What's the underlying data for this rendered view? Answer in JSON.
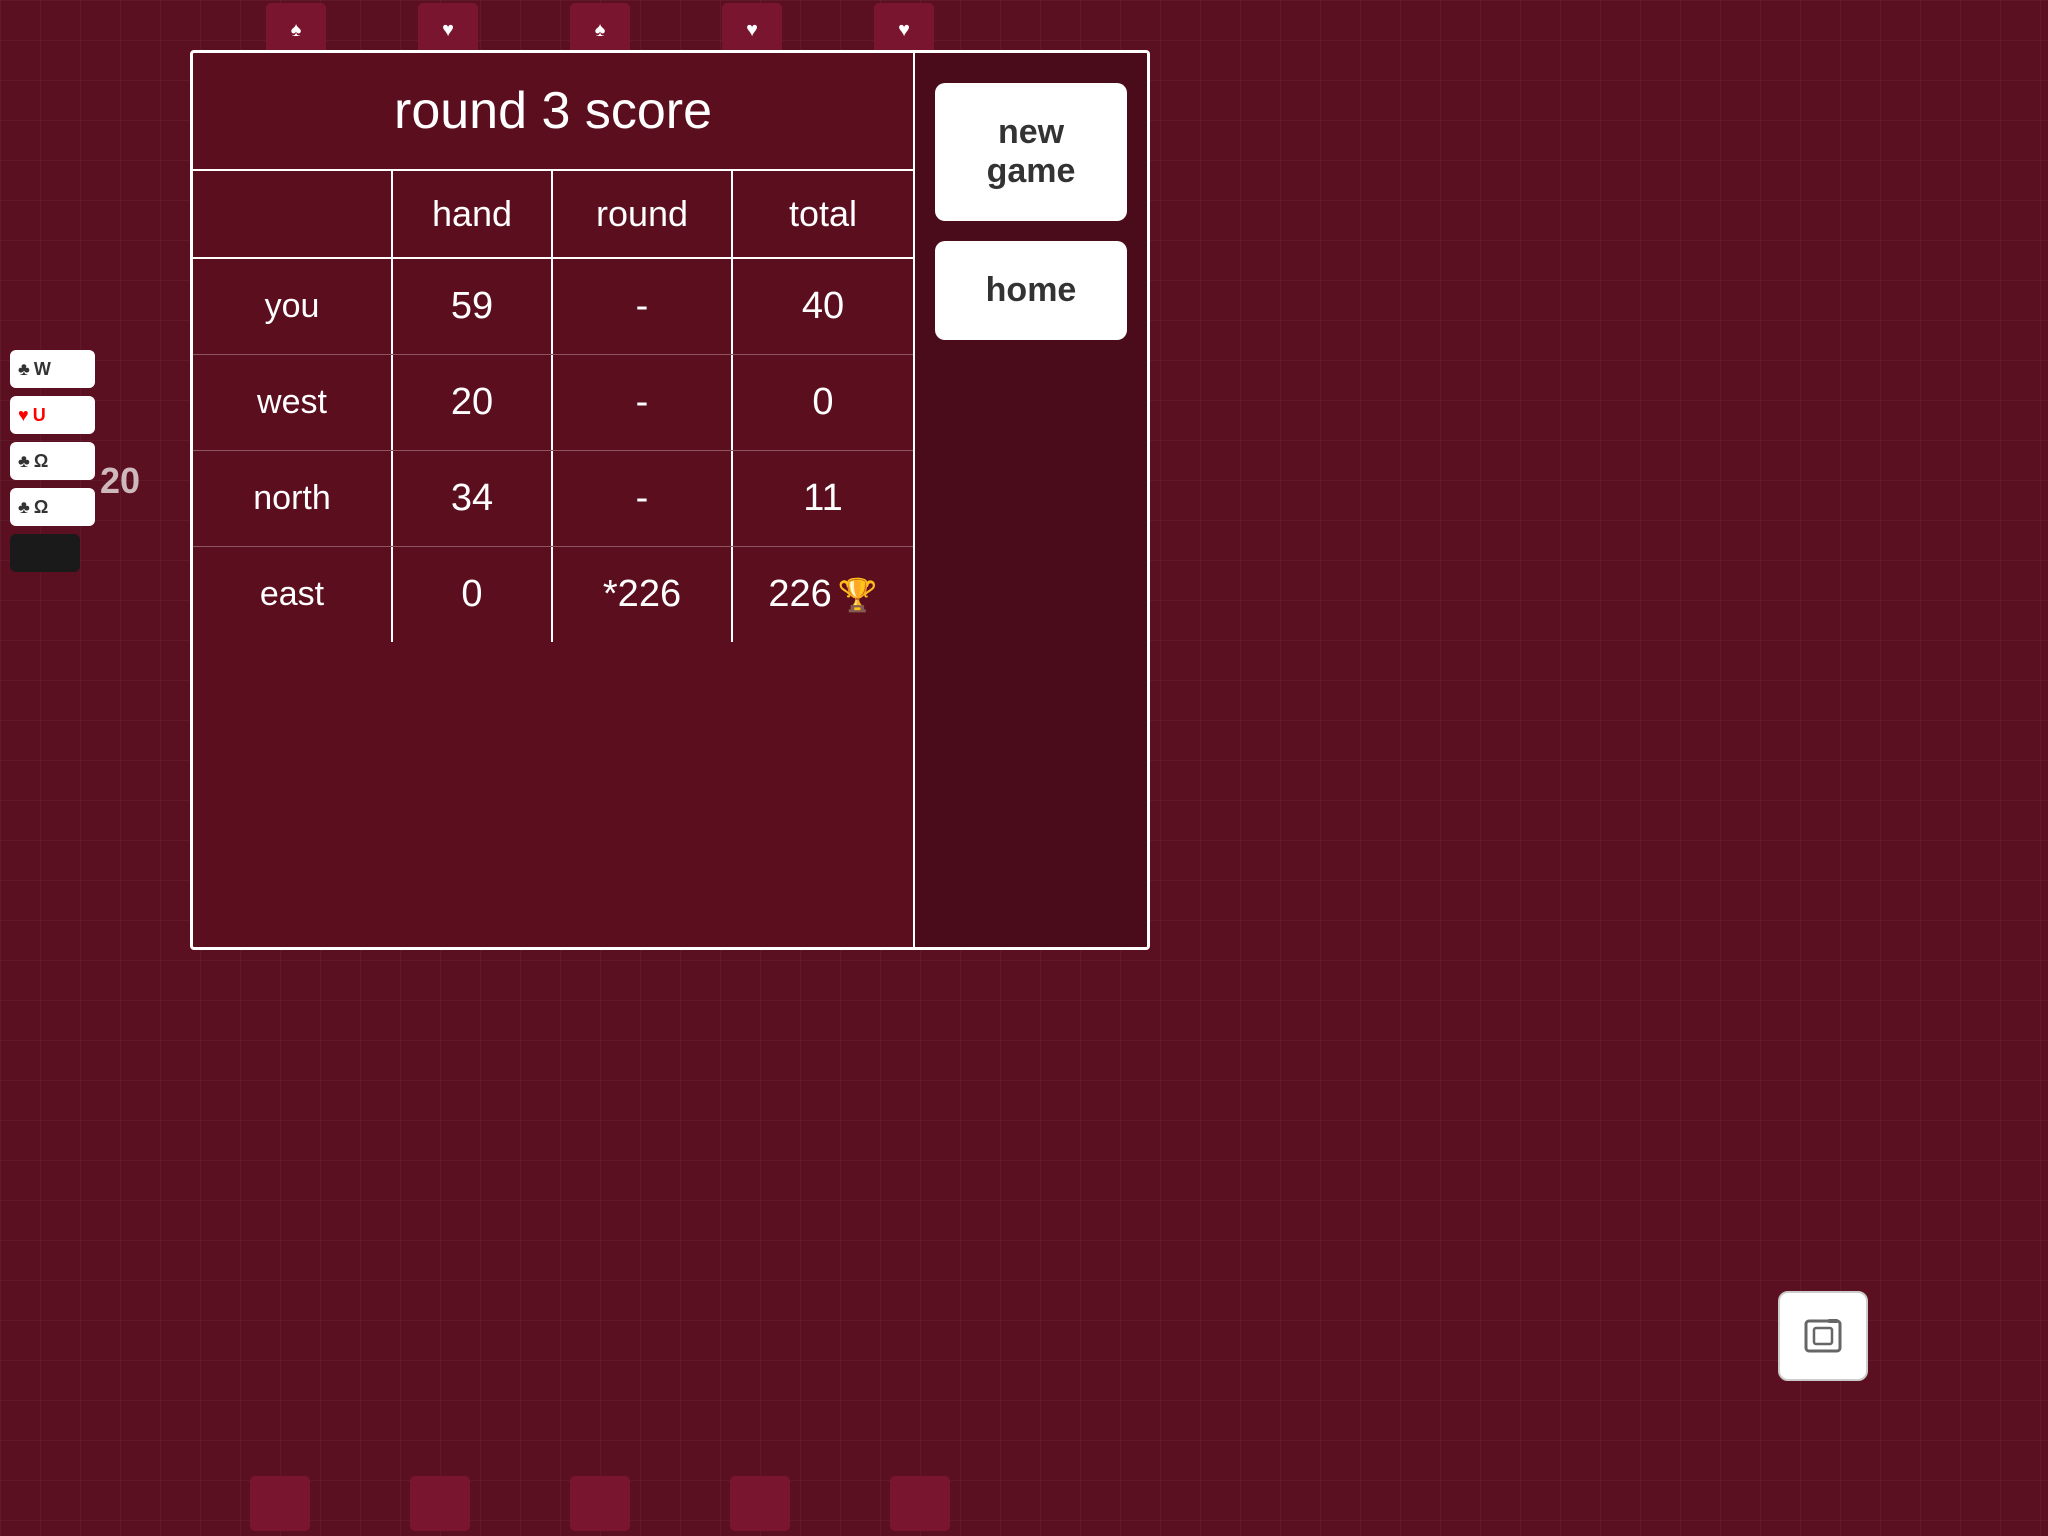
{
  "dialog": {
    "title": "round 3 score",
    "columns": {
      "player": "",
      "hand": "hand",
      "round": "round",
      "total": "total"
    },
    "rows": [
      {
        "player": "you",
        "hand": "59",
        "round": "-",
        "total": "40",
        "winner": false
      },
      {
        "player": "west",
        "hand": "20",
        "round": "-",
        "total": "0",
        "winner": false
      },
      {
        "player": "north",
        "hand": "34",
        "round": "-",
        "total": "11",
        "winner": false
      },
      {
        "player": "east",
        "hand": "0",
        "round": "*226",
        "total": "226",
        "winner": true
      }
    ],
    "buttons": {
      "new_game": "new game",
      "home": "home"
    }
  },
  "sidebar": {
    "number": "20"
  },
  "icons": {
    "trophy": "🏆",
    "screenshot": "⬛"
  }
}
